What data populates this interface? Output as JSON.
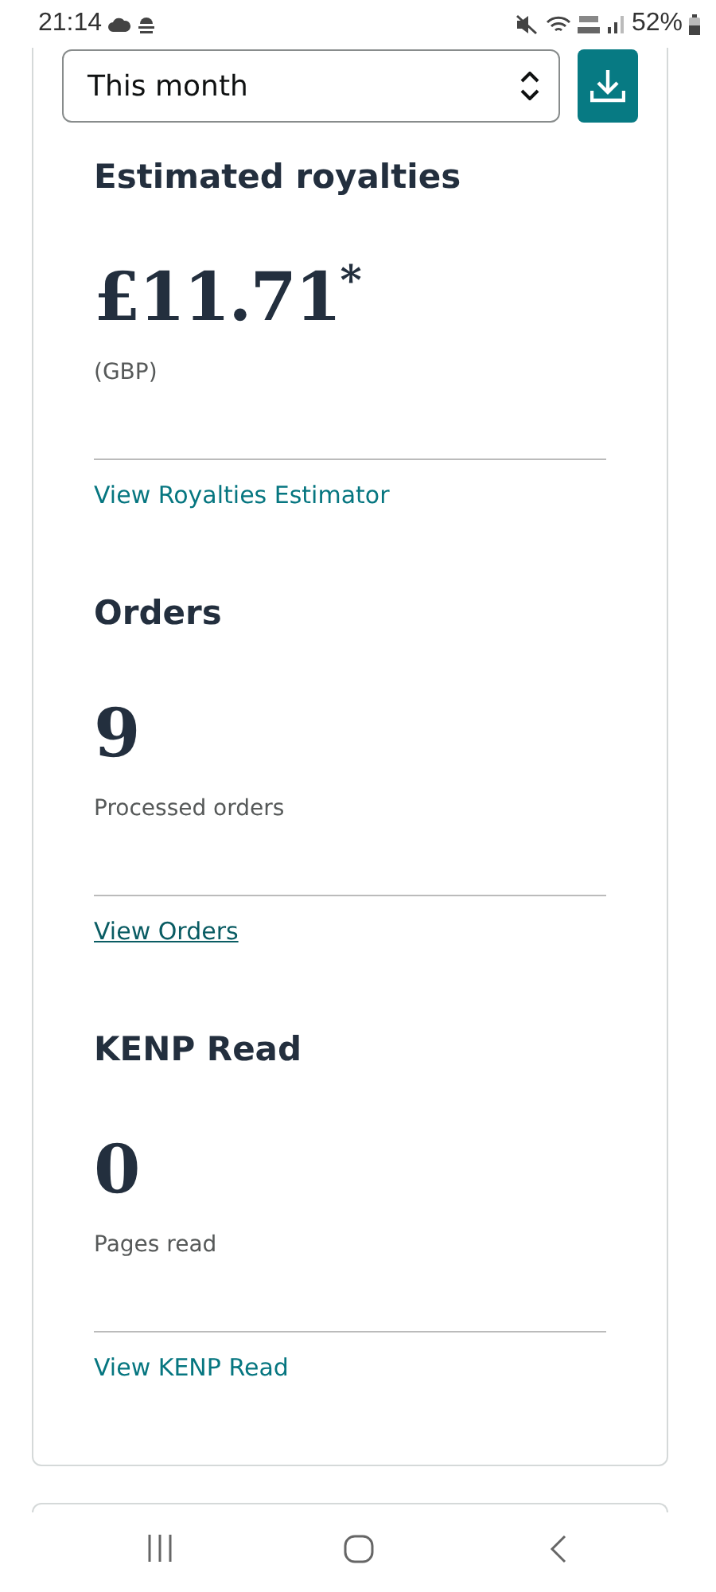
{
  "status_bar": {
    "time": "21:14",
    "battery": "52%"
  },
  "period_select": {
    "value": "This month"
  },
  "metrics": [
    {
      "title": "Estimated royalties",
      "value": "£11.71$^{*}$",
      "caption": "(GBP)",
      "link": "View Royalties Estimator",
      "focused": false
    },
    {
      "title": "Orders",
      "value": "9",
      "caption": "Processed orders",
      "link": "View Orders",
      "focused": true
    },
    {
      "title": "KENP Read",
      "value": "0",
      "caption": "Pages read",
      "link": "View KENP Read",
      "focused": false
    }
  ]
}
